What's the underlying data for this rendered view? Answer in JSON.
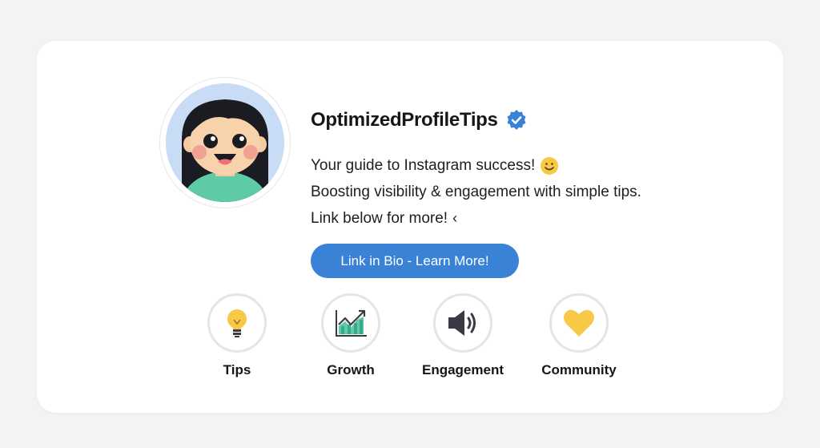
{
  "profile": {
    "username": "OptimizedProfileTips",
    "verified_badge_icon": "verified-check-icon",
    "avatar_icon": "cartoon-girl-avatar",
    "bio_lines": [
      "Your guide to Instagram success!",
      "Boosting visibility & engagement with simple tips.",
      "Link below for more!"
    ],
    "bio_line1_emoji_icon": "smiling-face-icon",
    "bio_line3_glyph": "‹",
    "cta_label": "Link in Bio - Learn More!"
  },
  "highlights": [
    {
      "label": "Tips",
      "icon": "lightbulb-icon"
    },
    {
      "label": "Growth",
      "icon": "growth-chart-icon"
    },
    {
      "label": "Engagement",
      "icon": "megaphone-icon"
    },
    {
      "label": "Community",
      "icon": "heart-icon"
    }
  ],
  "colors": {
    "accent": "#3a82d6",
    "verified": "#3a82d6",
    "background": "#f3f3f4",
    "card": "#ffffff",
    "highlight_ring": "#e2e5ea"
  }
}
